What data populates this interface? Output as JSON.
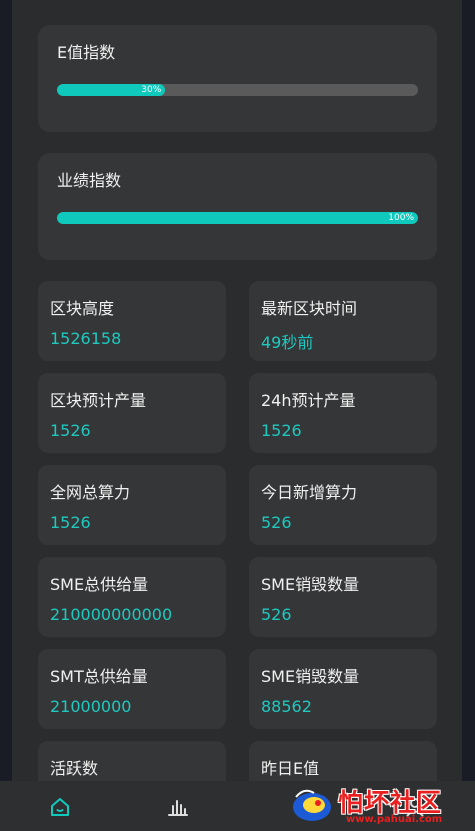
{
  "e_index": {
    "title": "E值指数",
    "percent_label": "30%",
    "progress": 0.3
  },
  "performance_index": {
    "title": "业绩指数",
    "percent_label": "100%",
    "progress": 1.0
  },
  "stats": [
    {
      "label": "区块高度",
      "value": "1526158"
    },
    {
      "label": "最新区块时间",
      "value": "49秒前"
    },
    {
      "label": "区块预计产量",
      "value": "1526"
    },
    {
      "label": "24h预计产量",
      "value": "1526"
    },
    {
      "label": "全网总算力",
      "value": "1526"
    },
    {
      "label": "今日新增算力",
      "value": "526"
    },
    {
      "label": "SME总供给量",
      "value": "210000000000"
    },
    {
      "label": "SME销毁数量",
      "value": "526"
    },
    {
      "label": "SMT总供给量",
      "value": "21000000"
    },
    {
      "label": "SME销毁数量",
      "value": "88562"
    },
    {
      "label": "活跃数",
      "value": ""
    },
    {
      "label": "昨日E值",
      "value": ""
    }
  ],
  "bottom_nav": {
    "items": [
      {
        "icon": "home-icon",
        "active": true
      },
      {
        "icon": "bar-chart-icon",
        "active": false
      },
      {
        "icon": "user-icon",
        "active": false
      }
    ]
  },
  "watermark": {
    "title": "怕坏社区",
    "url": "www.pahuai.com"
  },
  "colors": {
    "accent": "#10c9bd",
    "value_text": "#1ec9c0",
    "card": "#353637",
    "panel": "#2b2c2d",
    "track": "#5a5a5a"
  }
}
